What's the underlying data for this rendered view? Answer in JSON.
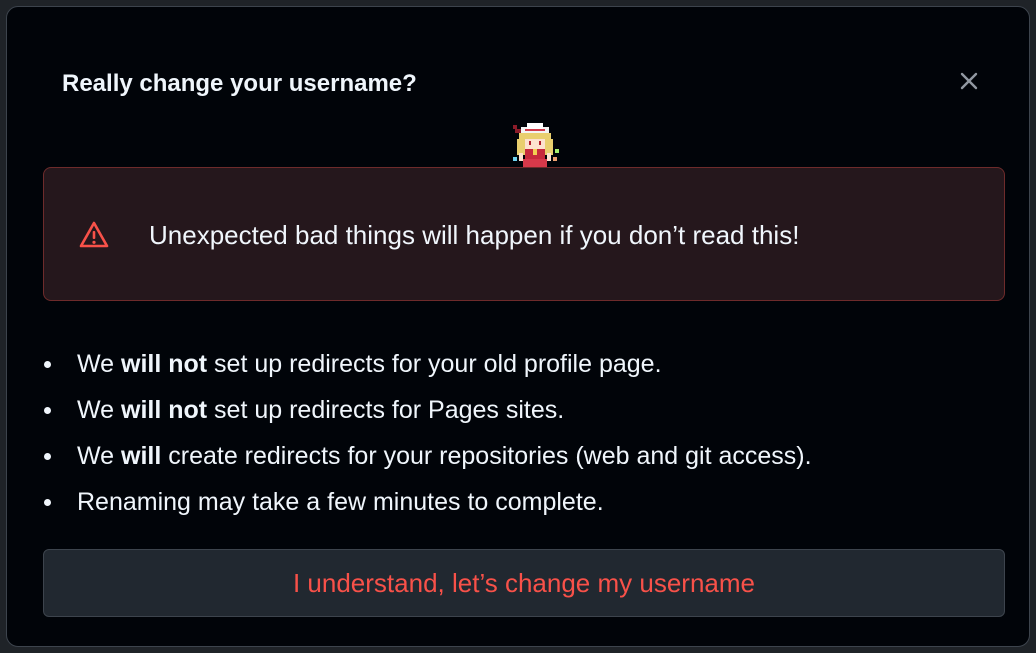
{
  "dialog": {
    "title": "Really change your username?",
    "close_icon": "x-icon"
  },
  "mascot": {
    "icon": "pixel-character-sprite"
  },
  "warning": {
    "icon": "alert-triangle-icon",
    "text": "Unexpected bad things will happen if you don’t read this!"
  },
  "notes": [
    {
      "prefix": "We ",
      "bold": "will not",
      "rest": " set up redirects for your old profile page."
    },
    {
      "prefix": "We ",
      "bold": "will not",
      "rest": " set up redirects for Pages sites."
    },
    {
      "prefix": "We ",
      "bold": "will",
      "rest": " create redirects for your repositories (web and git access)."
    },
    {
      "prefix": "",
      "bold": "",
      "rest": "Renaming may take a few minutes to complete."
    }
  ],
  "confirm_button": {
    "label": "I understand, let’s change my username"
  },
  "colors": {
    "background": "#010409",
    "text": "#f0f6fc",
    "danger": "#f85149",
    "flash_bg": "#25171c",
    "flash_border": "#6e2b2b",
    "button_bg": "#212830"
  }
}
